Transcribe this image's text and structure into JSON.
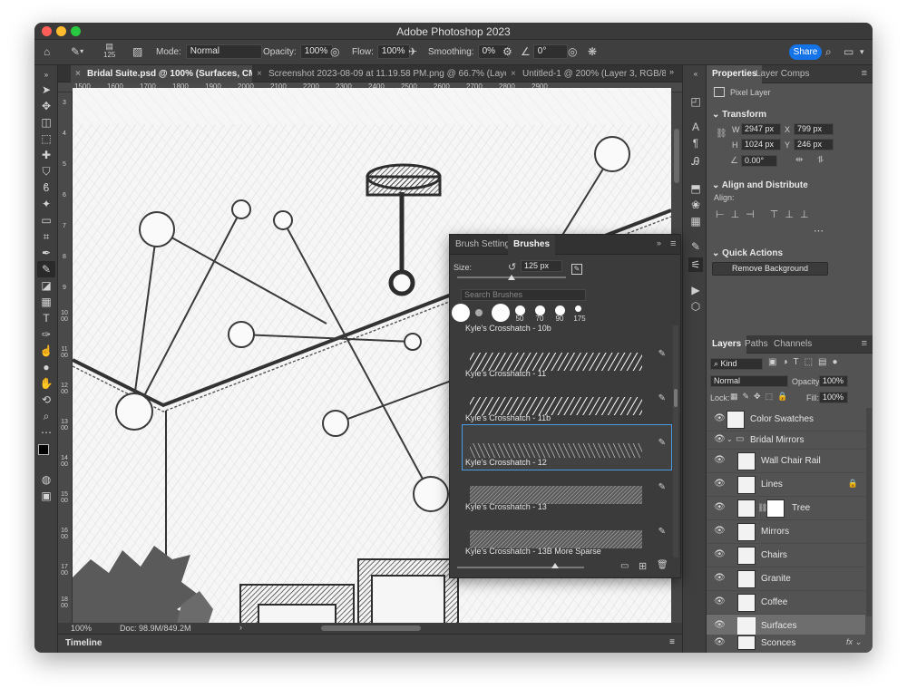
{
  "app": {
    "title": "Adobe Photoshop 2023"
  },
  "options": {
    "brush_size": "125",
    "mode_label": "Mode:",
    "mode_value": "Normal",
    "opacity_label": "Opacity:",
    "opacity_value": "100%",
    "flow_label": "Flow:",
    "flow_value": "100%",
    "smoothing_label": "Smoothing:",
    "smoothing_value": "0%",
    "angle_value": "0°",
    "share_label": "Share"
  },
  "tabs": [
    {
      "label": "Bridal Suite.psd @ 100% (Surfaces, CMYK/8) *"
    },
    {
      "label": "Screenshot 2023-08-09 at 11.19.58 PM.png @ 66.7% (Layer 1, RGB/..."
    },
    {
      "label": "Untitled-1 @ 200% (Layer 3, RGB/8*..."
    }
  ],
  "ruler_h": [
    "1500",
    "1600",
    "1700",
    "1800",
    "1900",
    "2000",
    "2100",
    "2200",
    "2300",
    "2400",
    "2500",
    "2600",
    "2700",
    "2800",
    "2900"
  ],
  "ruler_v": [
    "3",
    "4",
    "5",
    "6",
    "7",
    "8",
    "9",
    "1000",
    "1100",
    "1200",
    "1300",
    "1400",
    "1500",
    "1600",
    "1700",
    "1800"
  ],
  "status": {
    "zoom": "100%",
    "doc": "Doc: 98.9M/849.2M"
  },
  "timeline": {
    "label": "Timeline"
  },
  "properties": {
    "tab1": "Properties",
    "tab2": "Layer Comps",
    "kind": "Pixel Layer",
    "transform_label": "Transform",
    "w_label": "W",
    "w": "2947 px",
    "x_label": "X",
    "x": "799 px",
    "h_label": "H",
    "h": "1024 px",
    "y_label": "Y",
    "y": "246 px",
    "angle": "0.00°",
    "align_label": "Align and Distribute",
    "align_sub": "Align:",
    "quick_actions_label": "Quick Actions",
    "remove_bg": "Remove Background"
  },
  "layers_panel": {
    "tab1": "Layers",
    "tab2": "Paths",
    "tab3": "Channels",
    "kind_label": "Kind",
    "blend": "Normal",
    "opacity_label": "Opacity:",
    "opacity": "100%",
    "lock_label": "Lock:",
    "fill_label": "Fill:",
    "fill": "100%",
    "layers": [
      {
        "name": "Color Swatches"
      },
      {
        "name": "Bridal Mirrors"
      },
      {
        "name": "Wall Chair Rail"
      },
      {
        "name": "Lines"
      },
      {
        "name": "Tree"
      },
      {
        "name": "Mirrors"
      },
      {
        "name": "Chairs"
      },
      {
        "name": "Granite"
      },
      {
        "name": "Coffee"
      },
      {
        "name": "Surfaces"
      },
      {
        "name": "Sconces"
      }
    ]
  },
  "brushes": {
    "tab1": "Brush Settings",
    "tab2": "Brushes",
    "size_label": "Size:",
    "size_value": "125 px",
    "search_placeholder": "Search Brushes",
    "tip_sizes": [
      "50",
      "70",
      "90",
      "175"
    ],
    "items": [
      {
        "name": "Kyle's Crosshatch - 10b"
      },
      {
        "name": "Kyle's Crosshatch - 11"
      },
      {
        "name": "Kyle's Crosshatch - 11b"
      },
      {
        "name": "Kyle's Crosshatch - 12"
      },
      {
        "name": "Kyle's Crosshatch - 13"
      },
      {
        "name": "Kyle's Crosshatch - 13B More Sparse"
      }
    ]
  },
  "colors": {
    "accent": "#1473e6",
    "panel": "#535353",
    "selection": "#4b9be6"
  }
}
